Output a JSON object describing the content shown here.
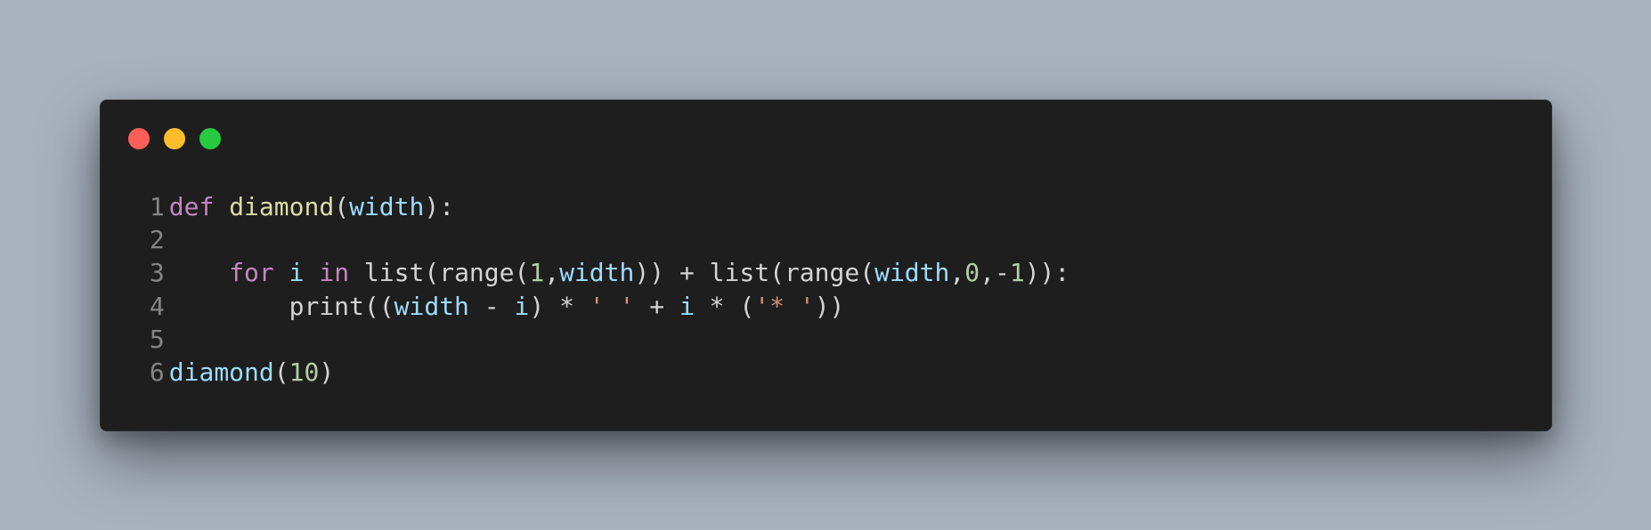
{
  "window": {
    "controls": [
      "close",
      "minimize",
      "maximize"
    ]
  },
  "code": {
    "lines": [
      {
        "number": "1",
        "tokens": [
          {
            "text": "def",
            "type": "kw"
          },
          {
            "text": " ",
            "type": "plain"
          },
          {
            "text": "diamond",
            "type": "fn"
          },
          {
            "text": "(",
            "type": "plain"
          },
          {
            "text": "width",
            "type": "var"
          },
          {
            "text": "):",
            "type": "plain"
          }
        ]
      },
      {
        "number": "2",
        "tokens": []
      },
      {
        "number": "3",
        "tokens": [
          {
            "text": "    ",
            "type": "plain"
          },
          {
            "text": "for",
            "type": "kw"
          },
          {
            "text": " ",
            "type": "plain"
          },
          {
            "text": "i",
            "type": "var"
          },
          {
            "text": " ",
            "type": "plain"
          },
          {
            "text": "in",
            "type": "kw"
          },
          {
            "text": " list(range(",
            "type": "plain"
          },
          {
            "text": "1",
            "type": "num"
          },
          {
            "text": ",",
            "type": "plain"
          },
          {
            "text": "width",
            "type": "var"
          },
          {
            "text": ")) + list(range(",
            "type": "plain"
          },
          {
            "text": "width",
            "type": "var"
          },
          {
            "text": ",",
            "type": "plain"
          },
          {
            "text": "0",
            "type": "num"
          },
          {
            "text": ",-",
            "type": "plain"
          },
          {
            "text": "1",
            "type": "num"
          },
          {
            "text": ")):",
            "type": "plain"
          }
        ]
      },
      {
        "number": "4",
        "tokens": [
          {
            "text": "        print((",
            "type": "plain"
          },
          {
            "text": "width",
            "type": "var"
          },
          {
            "text": " - ",
            "type": "plain"
          },
          {
            "text": "i",
            "type": "var"
          },
          {
            "text": ") * ",
            "type": "plain"
          },
          {
            "text": "' '",
            "type": "str"
          },
          {
            "text": " + ",
            "type": "plain"
          },
          {
            "text": "i",
            "type": "var"
          },
          {
            "text": " * (",
            "type": "plain"
          },
          {
            "text": "'* '",
            "type": "str"
          },
          {
            "text": "))",
            "type": "plain"
          }
        ]
      },
      {
        "number": "5",
        "tokens": []
      },
      {
        "number": "6",
        "tokens": [
          {
            "text": "diamond",
            "type": "var"
          },
          {
            "text": "(",
            "type": "plain"
          },
          {
            "text": "10",
            "type": "num"
          },
          {
            "text": ")",
            "type": "plain"
          }
        ]
      }
    ]
  },
  "colors": {
    "background": "#a8b3bf",
    "window": "#1e1e1e",
    "close": "#ff5f56",
    "minimize": "#ffbd2e",
    "maximize": "#27c93f",
    "keyword": "#c586c0",
    "function": "#dcdcaa",
    "variable": "#9cdcfe",
    "number": "#b5cea8",
    "string": "#ce9178",
    "text": "#d4d4d4",
    "line_number": "#858585"
  }
}
